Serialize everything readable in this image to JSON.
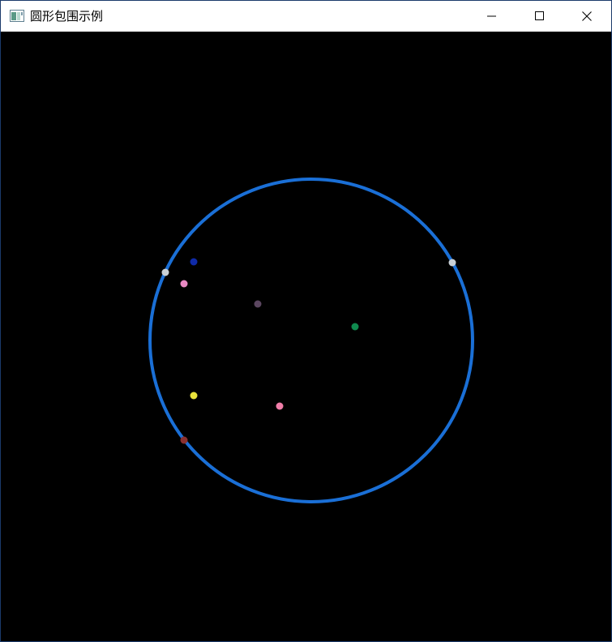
{
  "window": {
    "title": "圆形包围示例"
  },
  "icons": {
    "app": "app-window-icon",
    "minimize": "minimize-icon",
    "maximize": "maximize-icon",
    "close": "close-icon"
  },
  "colors": {
    "background": "#000000",
    "circle": "#1a6fd6"
  },
  "points": [
    {
      "name": "point-pink-1",
      "color": "#e889c3"
    },
    {
      "name": "point-blue",
      "color": "#0f2aa8"
    },
    {
      "name": "point-white-left",
      "color": "#c9d0d6"
    },
    {
      "name": "point-white-right",
      "color": "#c9d0d6"
    },
    {
      "name": "point-purple",
      "color": "#5b4660"
    },
    {
      "name": "point-green",
      "color": "#0f8a4e"
    },
    {
      "name": "point-yellow",
      "color": "#e9e23b"
    },
    {
      "name": "point-pink-2",
      "color": "#f07da8"
    },
    {
      "name": "point-red",
      "color": "#8a3030"
    }
  ]
}
